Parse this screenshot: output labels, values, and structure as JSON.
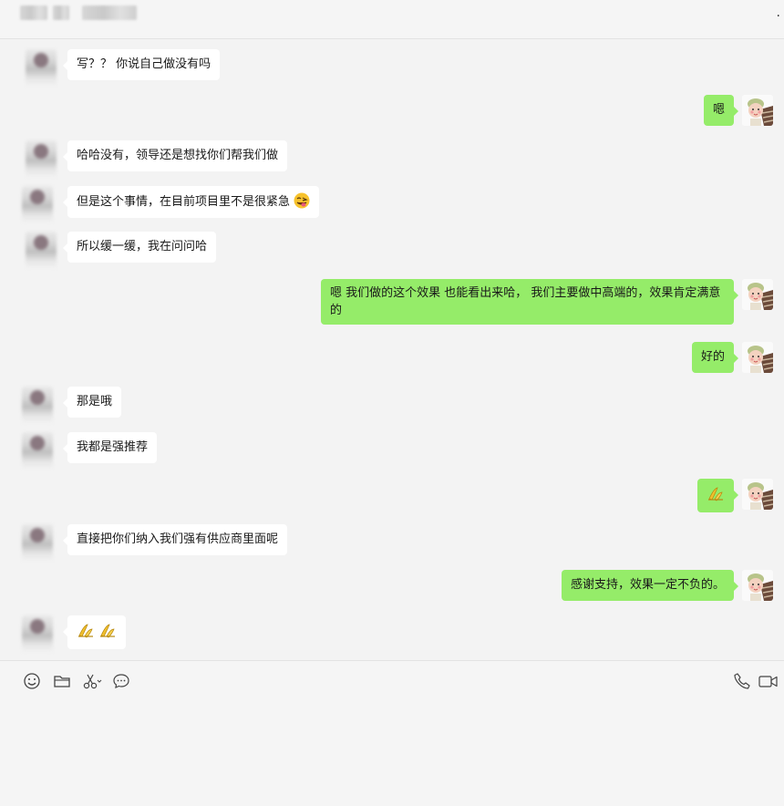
{
  "header": {
    "title": "",
    "more_icon": "more-icon"
  },
  "colors": {
    "background": "#f3f3f3",
    "incoming_bubble": "#ffffff",
    "outgoing_bubble": "#95ec69"
  },
  "messages": [
    {
      "side": "left",
      "text": "写？？ 你说自己做没有吗"
    },
    {
      "side": "right",
      "text": "嗯"
    },
    {
      "side": "left",
      "text": "哈哈没有，领导还是想找你们帮我们做"
    },
    {
      "side": "left",
      "text": "但是这个事情，在目前项目里不是很紧急",
      "emoji": "tongue-face-emoji"
    },
    {
      "side": "left",
      "text": "所以缓一缓，我在问问哈"
    },
    {
      "side": "right",
      "text": "嗯 我们做的这个效果 也能看出来哈， 我们主要做中高端的，效果肯定满意的"
    },
    {
      "side": "right",
      "text": "好的"
    },
    {
      "side": "left",
      "text": "那是哦"
    },
    {
      "side": "left",
      "text": "我都是强推荐"
    },
    {
      "side": "right",
      "text": "",
      "emoji": "banana-emoji"
    },
    {
      "side": "left",
      "text": "直接把你们纳入我们强有供应商里面呢"
    },
    {
      "side": "right",
      "text": "感谢支持，效果一定不负的。"
    },
    {
      "side": "left",
      "text": "",
      "emoji": "banana-emoji x2"
    }
  ],
  "toolbar": {
    "left_icons": [
      "emoji-icon",
      "folder-icon",
      "scissors-icon",
      "chat-bubble-icon"
    ],
    "right_icons": [
      "phone-icon",
      "video-call-icon"
    ]
  }
}
